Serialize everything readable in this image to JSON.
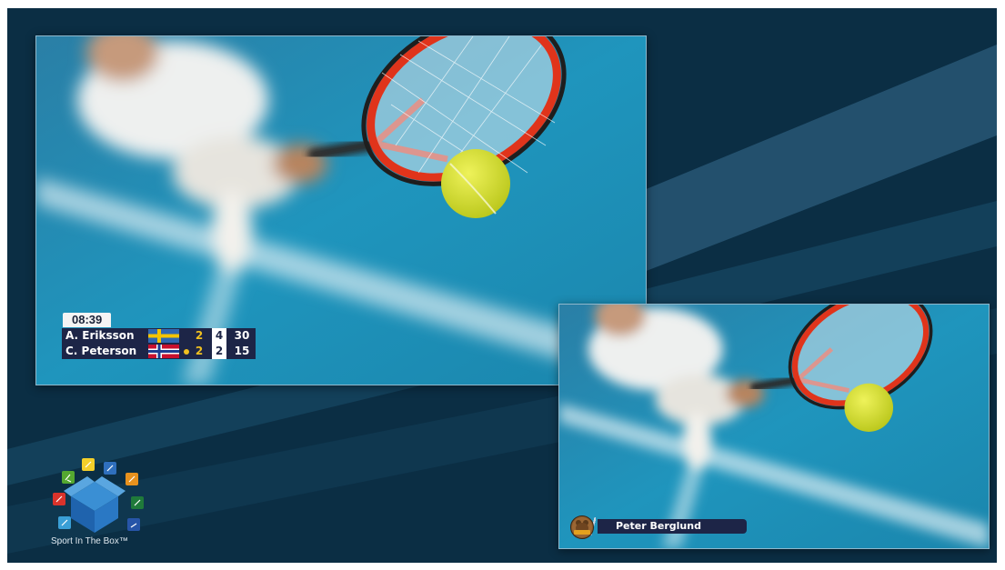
{
  "scoreboard": {
    "clock": "08:39",
    "players": [
      {
        "name": "A. Eriksson",
        "flag": "sweden-flag",
        "serving": false,
        "sets": "2",
        "games": "4",
        "points": "30"
      },
      {
        "name": "C. Peterson",
        "flag": "norway-flag",
        "serving": true,
        "sets": "2",
        "games": "2",
        "points": "15"
      }
    ]
  },
  "lower_third": {
    "name": "Peter Berglund",
    "badge": "grizzly-team-badge"
  },
  "brand": {
    "name": "Sport In The Box™"
  },
  "colors": {
    "background": "#0b2e44",
    "scoreboard": "#1d2547",
    "accent": "#f0c020",
    "court": "#1e8fb4",
    "racket": "#e0341b",
    "ball": "#d6e02a"
  }
}
